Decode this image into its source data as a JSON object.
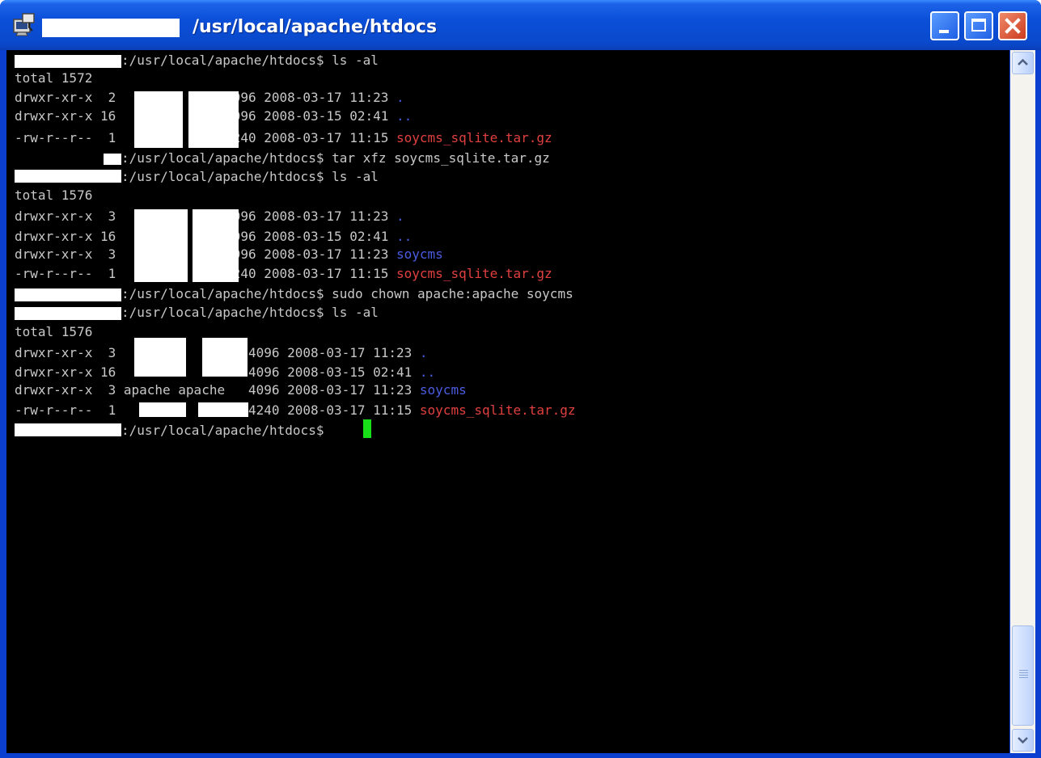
{
  "window": {
    "title": "/usr/local/apache/htdocs",
    "controls": {
      "minimize": "minimize-icon",
      "maximize": "maximize-icon",
      "close": "close-icon"
    }
  },
  "terminal": {
    "lines": [
      {
        "text": ":/usr/local/apache/htdocs$ ls -al"
      },
      {
        "text": "total 1572"
      },
      {
        "text": "drwxr-xr-x  2              4096 2008-03-17 11:23 ",
        "suffix": ".",
        "suffix_color": "blue"
      },
      {
        "text": "drwxr-xr-x 16              4096 2008-03-15 02:41 ",
        "suffix": "..",
        "suffix_color": "blue"
      },
      {
        "text": "-rw-r--r--  1           1594240 2008-03-17 11:15 ",
        "suffix": "soycms_sqlite.tar.gz",
        "suffix_color": "red"
      },
      {
        "text": ":/usr/local/apache/htdocs$ tar xfz soycms_sqlite.tar.gz"
      },
      {
        "text": ":/usr/local/apache/htdocs$ ls -al"
      },
      {
        "text": "total 1576"
      },
      {
        "text": "drwxr-xr-x  3              4096 2008-03-17 11:23 ",
        "suffix": ".",
        "suffix_color": "blue"
      },
      {
        "text": "drwxr-xr-x 16              4096 2008-03-15 02:41 ",
        "suffix": "..",
        "suffix_color": "blue"
      },
      {
        "text": "drwxr-xr-x  3              4096 2008-03-17 11:23 ",
        "suffix": "soycms",
        "suffix_color": "blue"
      },
      {
        "text": "-rw-r--r--  1           1594240 2008-03-17 11:15 ",
        "suffix": "soycms_sqlite.tar.gz",
        "suffix_color": "red"
      },
      {
        "text": ":/usr/local/apache/htdocs$ sudo chown apache:apache soycms"
      },
      {
        "text": ":/usr/local/apache/htdocs$ ls -al"
      },
      {
        "text": "total 1576"
      },
      {
        "text": "drwxr-xr-x  3                 4096 2008-03-17 11:23 ",
        "suffix": ".",
        "suffix_color": "blue"
      },
      {
        "text": "drwxr-xr-x 16                 4096 2008-03-15 02:41 ",
        "suffix": "..",
        "suffix_color": "blue"
      },
      {
        "text": "drwxr-xr-x  3 apache apache   4096 2008-03-17 11:23 ",
        "suffix": "soycms",
        "suffix_color": "blue"
      },
      {
        "text": "-rw-r--r--  1              1594240 2008-03-17 11:15 ",
        "suffix": "soycms_sqlite.tar.gz",
        "suffix_color": "red"
      },
      {
        "text": ":/usr/local/apache/htdocs$ "
      }
    ]
  }
}
